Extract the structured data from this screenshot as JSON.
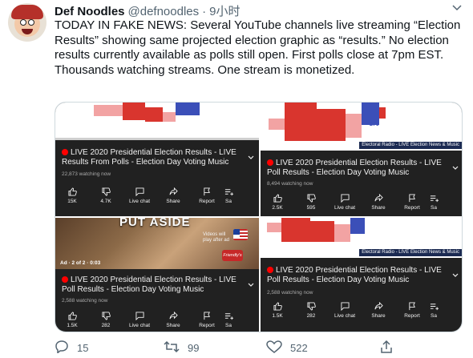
{
  "tweet": {
    "name": "Def Noodles",
    "handle": "@defnoodles",
    "separator": "·",
    "time": "9小时",
    "text": "TODAY IN FAKE NEWS: Several YouTube channels live streaming “Election Results” showing same projected election graphic as “results.” No election results currently available as polls still open. First polls close at 7pm EST. Thousands watching streams. One stream is monetized."
  },
  "streams": [
    {
      "title": "LIVE 2020 Presidential Election Results - LIVE Results From Polls  - Election Day Voting Music",
      "watching": "22,873 watching now",
      "likes": "15K",
      "dislikes": "4.7K"
    },
    {
      "title": "LIVE 2020 Presidential Election Results - LIVE Poll Results - Election Day Voting Music",
      "watching": "8,494 watching now",
      "likes": "2.5K",
      "dislikes": "595",
      "banner": "Electoral Radio - LIVE Election News & Music",
      "map_number": "270"
    },
    {
      "title": "LIVE 2020 Presidential Election Results - LIVE Poll Results - Election Day Voting Music",
      "watching": "2,588 watching now",
      "likes": "1.5K",
      "dislikes": "282",
      "ad_overlay": "PUT ASIDE",
      "ad_label": "Ad · 2 of 2 · 0:03",
      "ad_video_tag": "Videos will play after ad",
      "ad_brand": "Friendly's"
    },
    {
      "title": "LIVE 2020 Presidential Election Results - LIVE Poll Results - Election Day Voting Music",
      "watching": "2,588 watching now",
      "likes": "1.5K",
      "dislikes": "282",
      "banner": "Electoral Radio - LIVE Election News & Music"
    }
  ],
  "actions": {
    "live_chat": "Live chat",
    "share": "Share",
    "report": "Report",
    "save": "Sa"
  },
  "footer": {
    "replies": "15",
    "retweets": "99",
    "likes": "522"
  },
  "colors": {
    "live_red": "#ff0000",
    "panel_dark": "#212121",
    "text_secondary": "#536471",
    "state_red": "#d9352e",
    "state_blue": "#3b4fb8"
  }
}
